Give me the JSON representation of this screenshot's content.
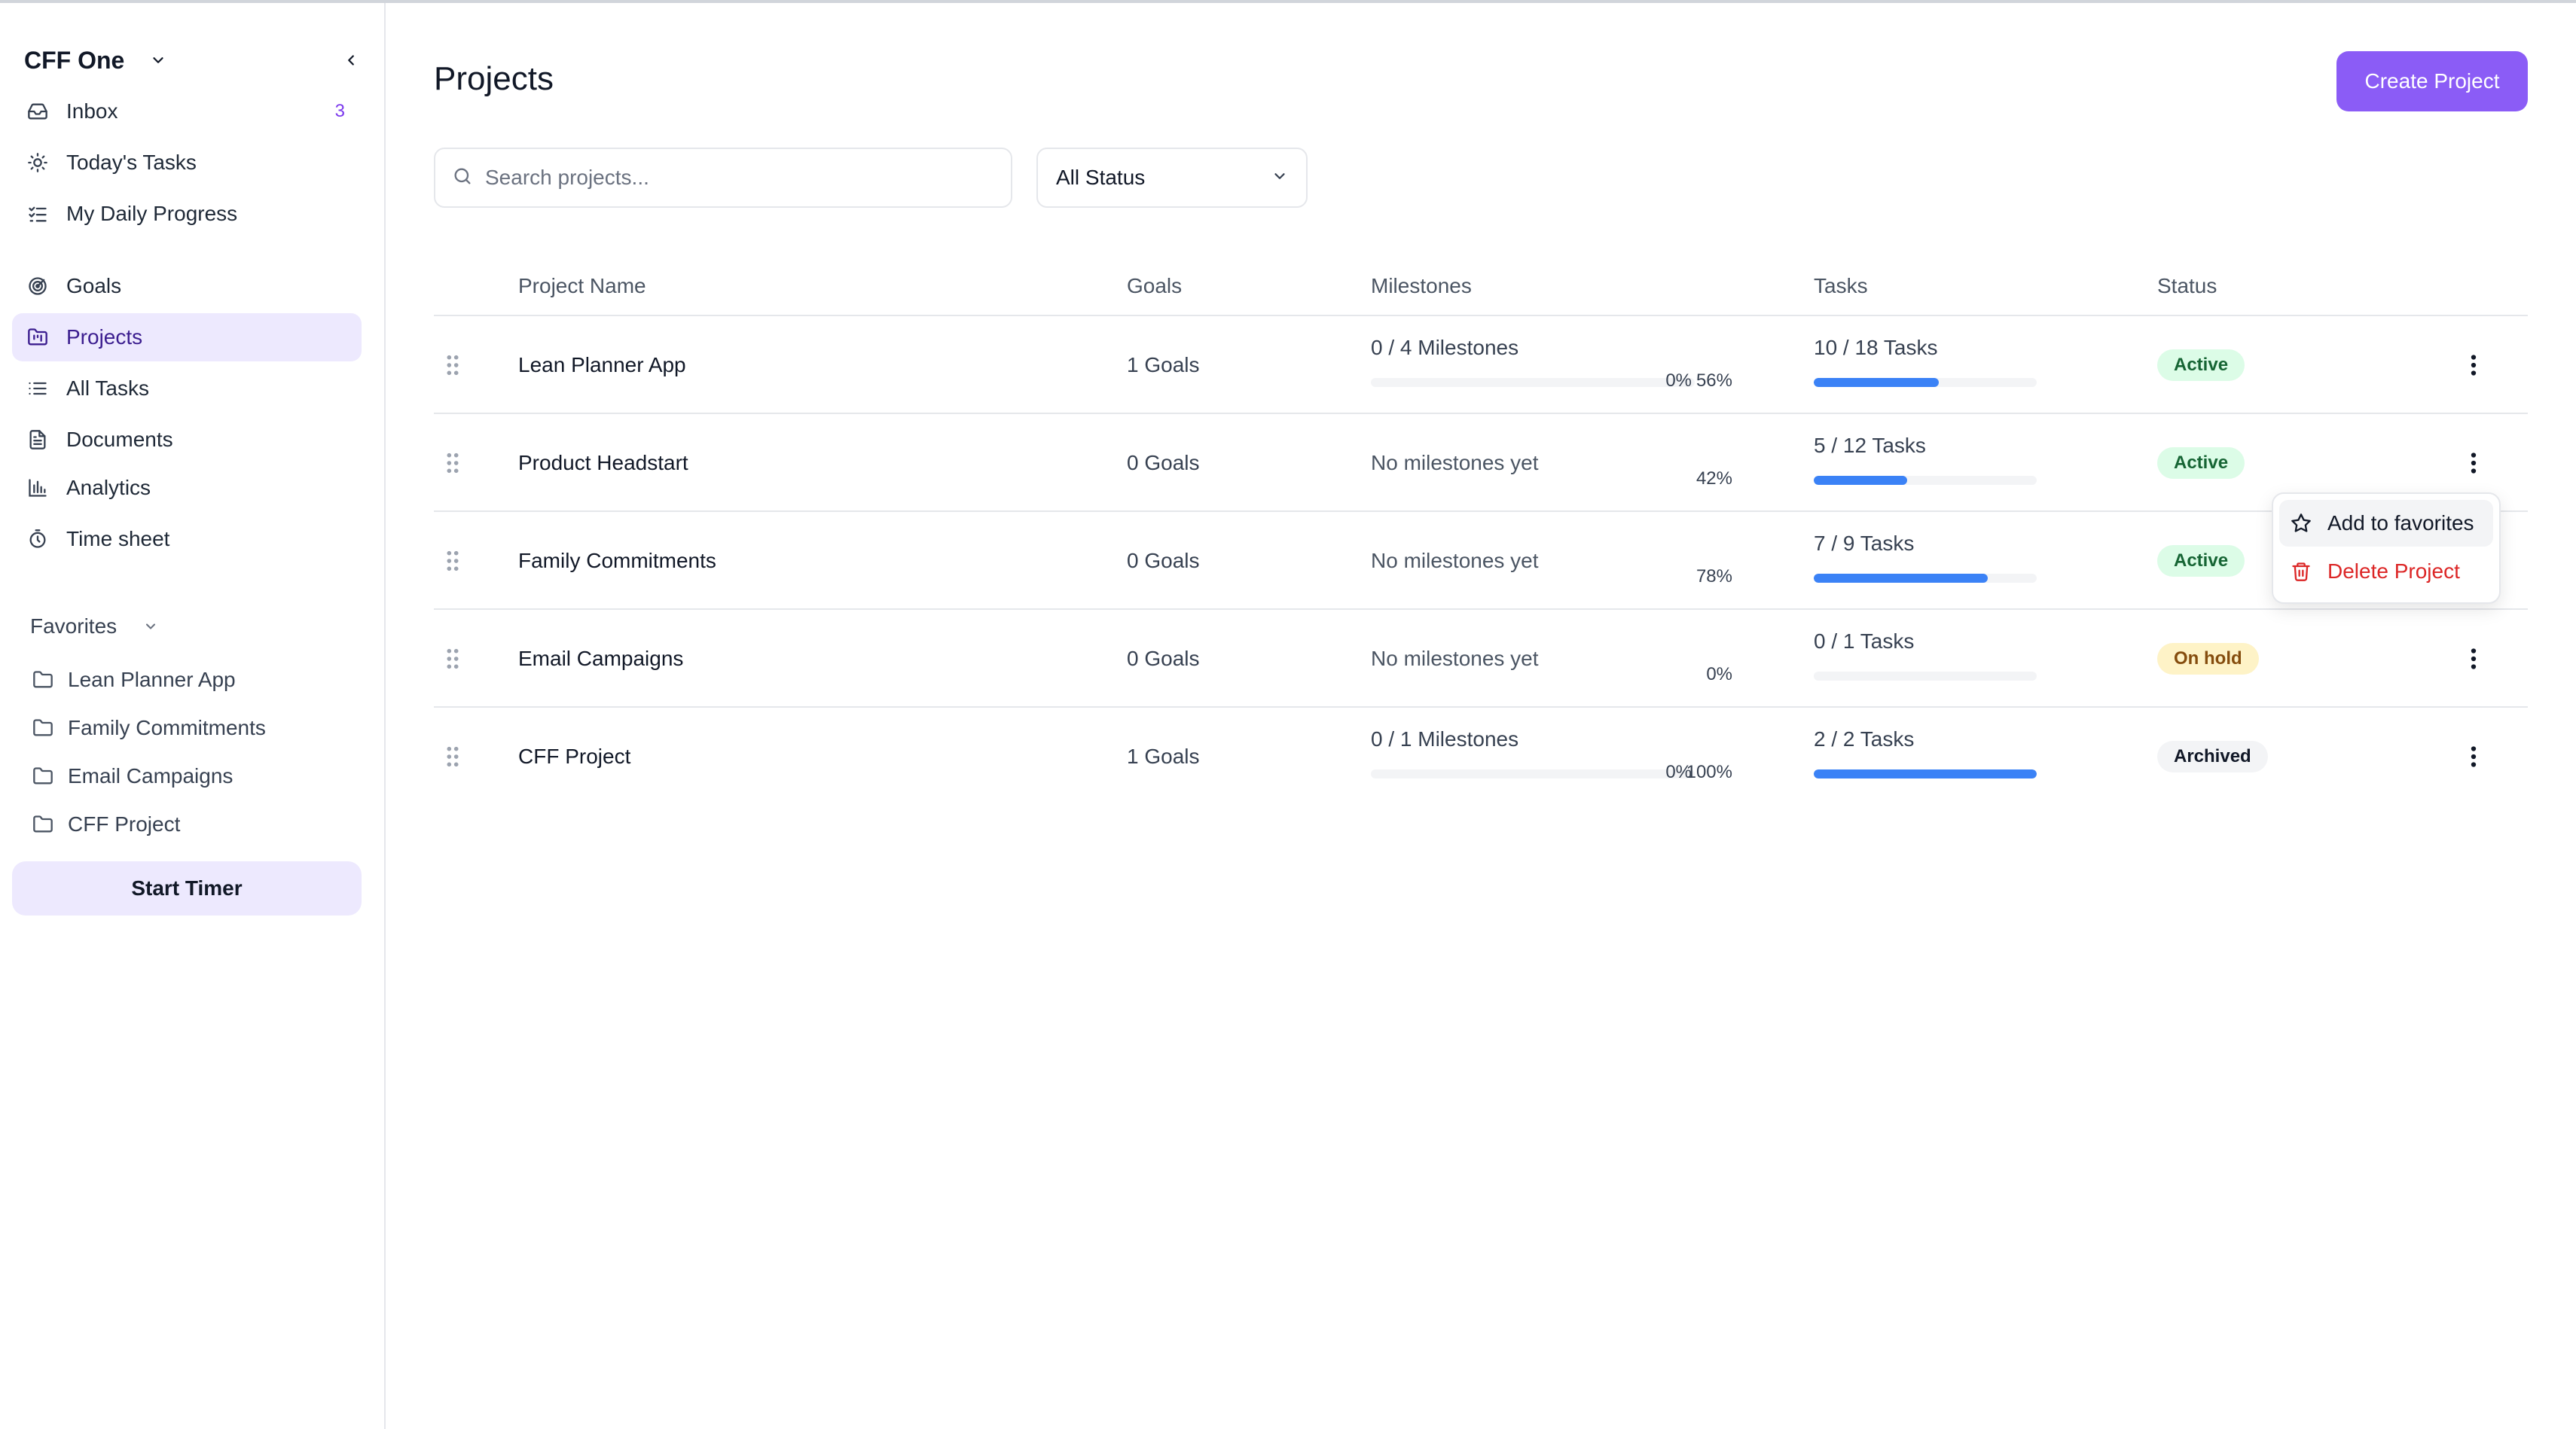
{
  "colors": {
    "accent": "#8b5cf6",
    "active_nav_bg": "#ede9fe",
    "progress": "#3b82f6",
    "danger": "#dc2626",
    "badge_active_bg": "#dcfce7",
    "badge_active_text": "#166534",
    "badge_onhold_bg": "#fef3c7",
    "badge_onhold_text": "#854d0e",
    "badge_archived_bg": "#f3f4f6",
    "badge_archived_text": "#111827"
  },
  "sidebar": {
    "workspace_name": "CFF One",
    "nav": [
      {
        "label": "Inbox",
        "icon": "inbox-icon",
        "badge": "3"
      },
      {
        "label": "Today's Tasks",
        "icon": "sun-icon"
      },
      {
        "label": "My Daily Progress",
        "icon": "checklist-icon"
      },
      {
        "label": "Goals",
        "icon": "target-icon"
      },
      {
        "label": "Projects",
        "icon": "folder-kanban-icon",
        "active": true
      },
      {
        "label": "All Tasks",
        "icon": "list-icon"
      },
      {
        "label": "Documents",
        "icon": "document-icon"
      },
      {
        "label": "Analytics",
        "icon": "bar-chart-icon"
      },
      {
        "label": "Time sheet",
        "icon": "timer-icon"
      }
    ],
    "favorites_label": "Favorites",
    "favorites": [
      "Lean Planner App",
      "Family Commitments",
      "Email Campaigns",
      "CFF Project"
    ],
    "start_timer_label": "Start Timer"
  },
  "main": {
    "title": "Projects",
    "create_button_label": "Create Project",
    "search_placeholder": "Search projects...",
    "status_filter": "All Status",
    "columns": [
      "Project Name",
      "Goals",
      "Milestones",
      "Tasks",
      "Status"
    ],
    "rows": [
      {
        "name": "Lean Planner App",
        "goals": "1 Goals",
        "milestones": "0 / 4 Milestones",
        "milestone_pct": "0%",
        "milestone_progress": 0,
        "tasks": "10 / 18 Tasks",
        "tasks_pct": "56%",
        "tasks_progress": 0.56,
        "status": "Active",
        "status_kind": "active"
      },
      {
        "name": "Product Headstart",
        "goals": "0 Goals",
        "milestones_empty": "No milestones yet",
        "tasks": "5 / 12 Tasks",
        "tasks_pct": "42%",
        "tasks_progress": 0.42,
        "status": "Active",
        "status_kind": "active"
      },
      {
        "name": "Family Commitments",
        "goals": "0 Goals",
        "milestones_empty": "No milestones yet",
        "tasks": "7 / 9 Tasks",
        "tasks_pct": "78%",
        "tasks_progress": 0.78,
        "status": "Active",
        "status_kind": "active"
      },
      {
        "name": "Email Campaigns",
        "goals": "0 Goals",
        "milestones_empty": "No milestones yet",
        "tasks": "0 / 1 Tasks",
        "tasks_pct": "0%",
        "tasks_progress": 0,
        "status": "On hold",
        "status_kind": "onhold"
      },
      {
        "name": "CFF Project",
        "goals": "1 Goals",
        "milestones": "0 / 1 Milestones",
        "milestone_pct": "0%",
        "milestone_progress": 0,
        "tasks": "2 / 2 Tasks",
        "tasks_pct": "100%",
        "tasks_progress": 1.0,
        "status": "Archived",
        "status_kind": "archived"
      }
    ]
  },
  "context_menu": {
    "items": [
      {
        "label": "Add to favorites",
        "icon": "star-icon"
      },
      {
        "label": "Delete Project",
        "icon": "trash-icon",
        "danger": true
      }
    ]
  }
}
